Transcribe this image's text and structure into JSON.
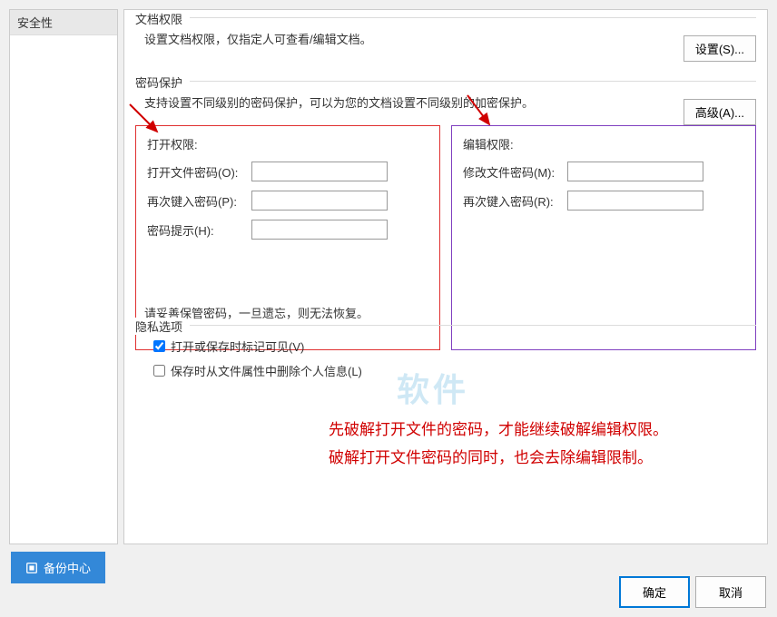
{
  "sidebar": {
    "item": "安全性"
  },
  "docperm": {
    "title": "文档权限",
    "desc": "设置文档权限，仅指定人可查看/编辑文档。",
    "btn": "设置(S)..."
  },
  "pwdprot": {
    "title": "密码保护",
    "desc": "支持设置不同级别的密码保护，可以为您的文档设置不同级别的加密保护。",
    "btn": "高级(A)...",
    "open": {
      "title": "打开权限:",
      "f1": "打开文件密码(O):",
      "f2": "再次键入密码(P):",
      "f3": "密码提示(H):"
    },
    "edit": {
      "title": "编辑权限:",
      "f1": "修改文件密码(M):",
      "f2": "再次键入密码(R):"
    },
    "warn": "请妥善保管密码，一旦遗忘，则无法恢复。"
  },
  "privacy": {
    "title": "隐私选项",
    "chk1": "打开或保存时标记可见(V)",
    "chk2": "保存时从文件属性中删除个人信息(L)"
  },
  "annot": {
    "l1": "先破解打开文件的密码，才能继续破解编辑权限。",
    "l2": "破解打开文件密码的同时，也会去除编辑限制。"
  },
  "watermark": "软件",
  "backup": "备份中心",
  "buttons": {
    "ok": "确定",
    "cancel": "取消"
  }
}
